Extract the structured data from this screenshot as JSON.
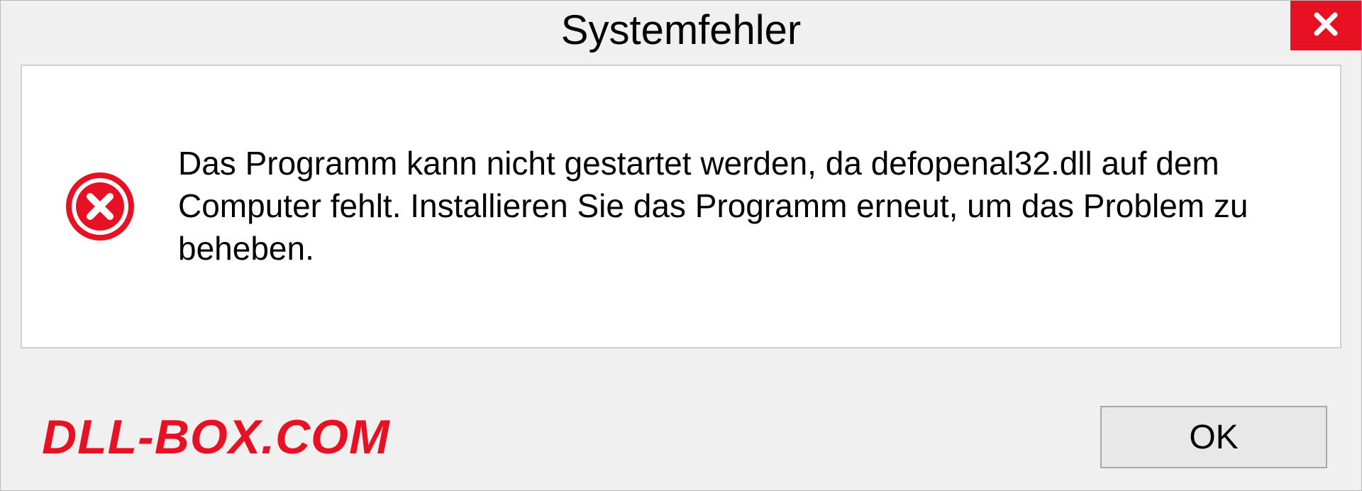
{
  "dialog": {
    "title": "Systemfehler",
    "message": "Das Programm kann nicht gestartet werden, da defopenal32.dll auf dem Computer fehlt. Installieren Sie das Programm erneut, um das Problem zu beheben.",
    "ok_label": "OK"
  },
  "watermark": "DLL-BOX.COM",
  "colors": {
    "close_red": "#e81123",
    "error_red": "#e81123",
    "watermark_red": "#e81123"
  }
}
